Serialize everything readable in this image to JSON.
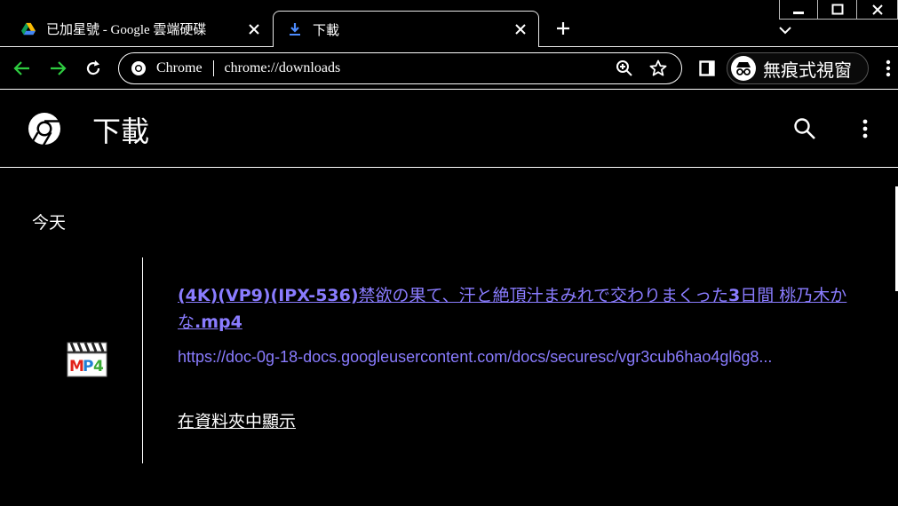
{
  "window": {
    "minimize_label": "minimize",
    "maximize_label": "maximize",
    "close_label": "close"
  },
  "tabs": [
    {
      "title": "已加星號 - Google 雲端硬碟",
      "icon": "google-drive-icon",
      "active": false
    },
    {
      "title": "下載",
      "icon": "download-icon",
      "active": true
    }
  ],
  "toolbar": {
    "back_icon": "back-arrow-icon",
    "forward_icon": "forward-arrow-icon",
    "reload_icon": "reload-icon",
    "omnibox": {
      "chip": "Chrome",
      "url": "chrome://downloads"
    },
    "incognito_label": "無痕式視窗"
  },
  "page": {
    "title": "下載",
    "date_group": "今天",
    "downloads": [
      {
        "file_name_bold_1": "(4K)(VP9)(IPX-536)",
        "file_name_part_2": "禁欲の果て、汗と絶頂汁まみれで交わりまくった",
        "file_name_bold_3": "3",
        "file_name_part_4": "日間 桃乃木かな",
        "file_name_bold_5": ".mp4",
        "url": "https://doc-0g-18-docs.googleusercontent.com/docs/securesc/vgr3cub6hao4gl6g8...",
        "show_in_folder": "在資料夾中顯示",
        "file_type_icon": "mp4-file-icon"
      }
    ]
  },
  "colors": {
    "background": "#000000",
    "link": "#8a7cff",
    "forward_green": "#2ecc40",
    "text": "#ffffff"
  }
}
